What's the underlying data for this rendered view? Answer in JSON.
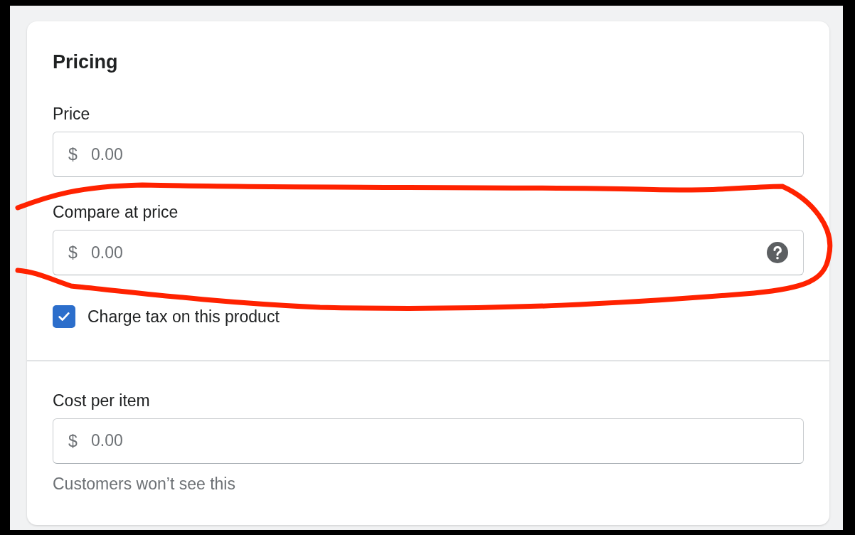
{
  "card": {
    "title": "Pricing",
    "sections": [
      {
        "fields": [
          {
            "kind": "money",
            "label": "Price",
            "prefix": "$",
            "placeholder": "0.00",
            "help_icon": false
          },
          {
            "kind": "money",
            "label": "Compare at price",
            "prefix": "$",
            "placeholder": "0.00",
            "help_icon": true
          },
          {
            "kind": "checkbox",
            "label": "Charge tax on this product",
            "checked": true
          }
        ]
      },
      {
        "fields": [
          {
            "kind": "money",
            "label": "Cost per item",
            "prefix": "$",
            "placeholder": "0.00",
            "help_icon": false,
            "help_text": "Customers won’t see this"
          }
        ]
      }
    ]
  },
  "annotation": {
    "kind": "loop",
    "color": "#ff2200"
  }
}
